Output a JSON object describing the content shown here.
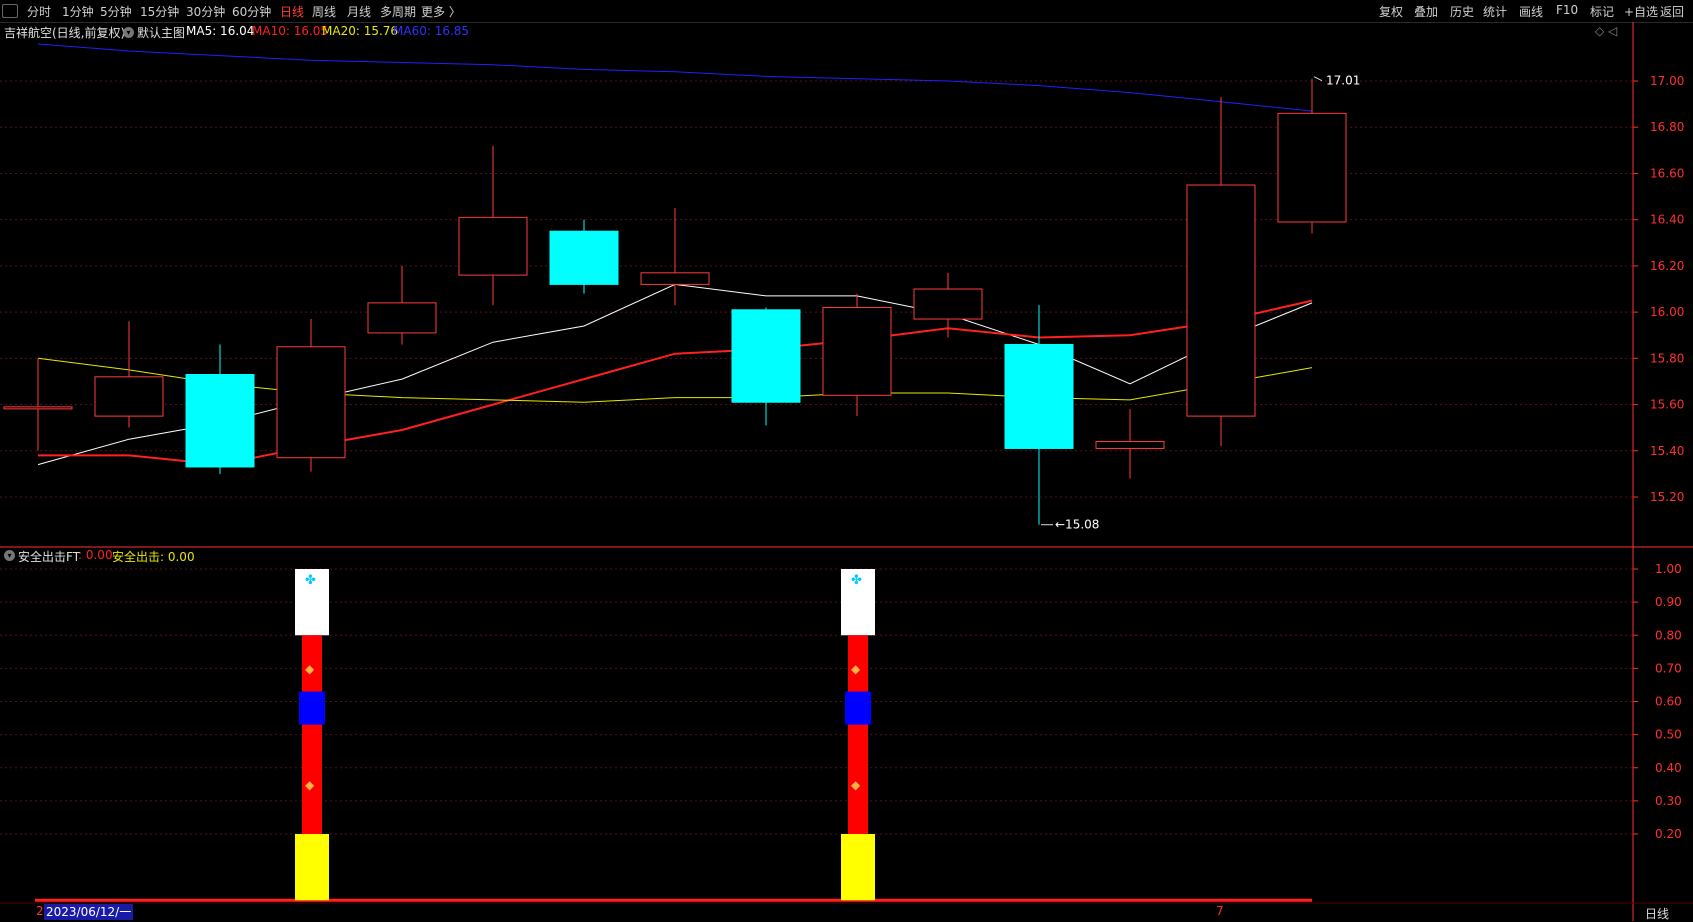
{
  "toolbar": {
    "periods": [
      "分时",
      "1分钟",
      "5分钟",
      "15分钟",
      "30分钟",
      "60分钟",
      "日线",
      "周线",
      "月线",
      "多周期",
      "更多 〉"
    ],
    "active_period": "日线",
    "right_items": [
      "复权",
      "叠加",
      "历史",
      "统计",
      "画线",
      "F10",
      "标记",
      "+自选",
      "返回"
    ]
  },
  "main_info": {
    "title": "吉祥航空(日线,前复权)",
    "indicator_name": "默认主图",
    "ma5": "MA5: 16.04",
    "ma10": "MA10: 16.05",
    "ma20": "MA20: 15.76",
    "ma60": "MA60: 16.85"
  },
  "sub_info": {
    "name": "安全出击FT",
    "value1": ": 0.00",
    "value2": "安全出击: 0.00"
  },
  "annotations": {
    "high": "17.01",
    "low": "15.08"
  },
  "bottom": {
    "date_cursor": "2023/06/12/一",
    "period_tab": "日线",
    "left_mark": "2",
    "right_mark": "7"
  },
  "colors": {
    "up": "#ff3b3b",
    "down": "#00ffff",
    "ma5": "#ffffff",
    "ma10": "#ff2020",
    "ma20": "#e8e800",
    "ma60": "#2020ff",
    "grid": "#5a1010",
    "axis": "#ff3030"
  },
  "chart_data": [
    {
      "type": "candlestick",
      "title": "吉祥航空(日线,前复权)",
      "y_ticks": [
        "17.00",
        "16.80",
        "16.60",
        "16.40",
        "16.20",
        "16.00",
        "15.80",
        "15.60",
        "15.40",
        "15.20"
      ],
      "ylim": [
        15.0,
        17.15
      ],
      "candles": [
        {
          "open": 15.59,
          "close": 15.59,
          "high": 15.8,
          "low": 15.4
        },
        {
          "open": 15.55,
          "close": 15.72,
          "high": 15.96,
          "low": 15.5
        },
        {
          "open": 15.73,
          "close": 15.33,
          "high": 15.86,
          "low": 15.3
        },
        {
          "open": 15.37,
          "close": 15.85,
          "high": 15.97,
          "low": 15.31
        },
        {
          "open": 15.91,
          "close": 16.04,
          "high": 16.2,
          "low": 15.86
        },
        {
          "open": 16.16,
          "close": 16.41,
          "high": 16.72,
          "low": 16.03
        },
        {
          "open": 16.35,
          "close": 16.12,
          "high": 16.4,
          "low": 16.08
        },
        {
          "open": 16.12,
          "close": 16.17,
          "high": 16.45,
          "low": 16.03
        },
        {
          "open": 16.01,
          "close": 15.61,
          "high": 16.02,
          "low": 15.51
        },
        {
          "open": 15.64,
          "close": 16.02,
          "high": 16.08,
          "low": 15.55
        },
        {
          "open": 15.97,
          "close": 16.1,
          "high": 16.17,
          "low": 15.89
        },
        {
          "open": 15.86,
          "close": 15.41,
          "high": 16.03,
          "low": 15.08
        },
        {
          "open": 15.41,
          "close": 15.44,
          "high": 15.58,
          "low": 15.28
        },
        {
          "open": 15.55,
          "close": 16.55,
          "high": 16.93,
          "low": 15.42
        },
        {
          "open": 16.39,
          "close": 16.86,
          "high": 17.01,
          "low": 16.34
        }
      ],
      "series": [
        {
          "name": "MA5",
          "values": [
            15.34,
            15.45,
            15.52,
            15.62,
            15.71,
            15.87,
            15.94,
            16.12,
            16.07,
            16.07,
            15.99,
            15.86,
            15.69,
            15.88,
            16.04
          ]
        },
        {
          "name": "MA10",
          "values": [
            15.38,
            15.38,
            15.34,
            15.42,
            15.49,
            15.6,
            15.71,
            15.82,
            15.84,
            15.88,
            15.93,
            15.89,
            15.9,
            15.96,
            16.05
          ]
        },
        {
          "name": "MA20",
          "values": [
            15.8,
            15.75,
            15.69,
            15.65,
            15.63,
            15.62,
            15.61,
            15.63,
            15.63,
            15.65,
            15.65,
            15.63,
            15.62,
            15.69,
            15.76
          ]
        },
        {
          "name": "MA60",
          "values": [
            17.16,
            17.13,
            17.11,
            17.09,
            17.08,
            17.07,
            17.05,
            17.04,
            17.02,
            17.01,
            17.0,
            16.98,
            16.95,
            16.91,
            16.87
          ]
        }
      ]
    },
    {
      "type": "bar",
      "title": "安全出击FT",
      "y_ticks": [
        "1.00",
        "0.90",
        "0.80",
        "0.70",
        "0.60",
        "0.50",
        "0.40",
        "0.30",
        "0.20"
      ],
      "ylim": [
        0,
        1.05
      ],
      "signals": [
        {
          "index": 3,
          "value": 1.0
        },
        {
          "index": 9,
          "value": 1.0
        }
      ]
    }
  ]
}
